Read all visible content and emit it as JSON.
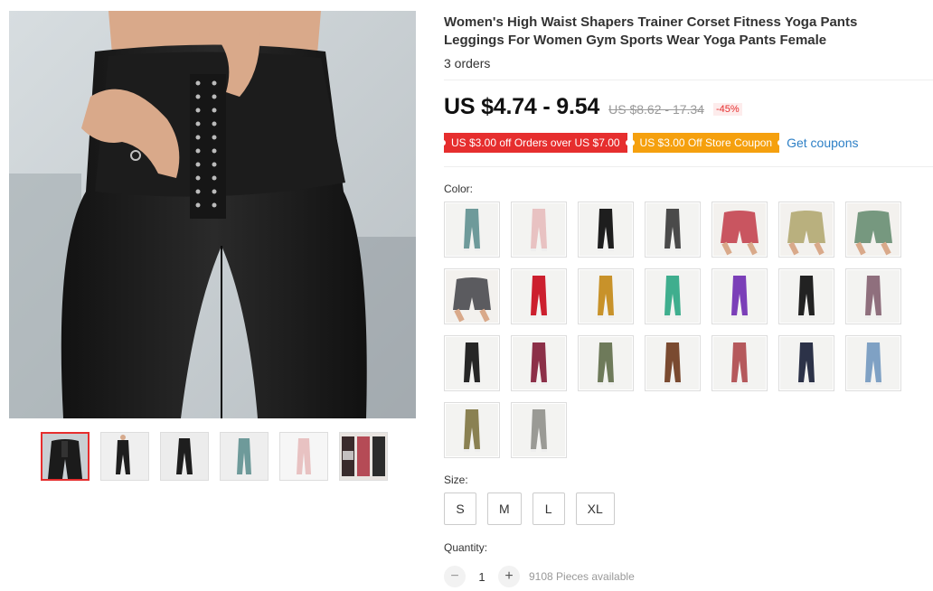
{
  "product": {
    "title": "Women's High Waist Shapers Trainer Corset Fitness Yoga Pants Leggings For Women Gym Sports Wear Yoga Pants Female",
    "orders": "3 orders",
    "price": "US $4.74 - 9.54",
    "old_price": "US $8.62 - 17.34",
    "discount": "-45%"
  },
  "coupons": {
    "store_discount": "US $3.00 off Orders over US $7.00",
    "store_coupon": "US $3.00 Off Store Coupon",
    "get_coupons": "Get coupons"
  },
  "colors": {
    "accent": "#e62e2e",
    "coupon_orange": "#f5a00e",
    "link": "#2e80c6"
  },
  "thumbnails": [
    {
      "name": "black-corset-leggings"
    },
    {
      "name": "black-leggings"
    },
    {
      "name": "black-leggings-2"
    },
    {
      "name": "teal-leggings"
    },
    {
      "name": "pink-leggings"
    },
    {
      "name": "collage"
    }
  ],
  "color_label": "Color:",
  "color_options": [
    {
      "name": "teal",
      "color": "#6e9a9a",
      "style": "leggings"
    },
    {
      "name": "light-pink",
      "color": "#e8c2c2",
      "style": "leggings"
    },
    {
      "name": "black",
      "color": "#1e1e1e",
      "style": "leggings"
    },
    {
      "name": "dark-gray",
      "color": "#4a4a4a",
      "style": "leggings"
    },
    {
      "name": "rose-red",
      "color": "#c95560",
      "style": "shorts"
    },
    {
      "name": "khaki",
      "color": "#b9b07e",
      "style": "shorts"
    },
    {
      "name": "sage-green",
      "color": "#76987f",
      "style": "shorts"
    },
    {
      "name": "gray-shorts",
      "color": "#5b5b5f",
      "style": "shorts"
    },
    {
      "name": "red",
      "color": "#cc1f2e",
      "style": "leggings"
    },
    {
      "name": "mustard",
      "color": "#c8922a",
      "style": "leggings"
    },
    {
      "name": "mint-green",
      "color": "#3fae8e",
      "style": "leggings"
    },
    {
      "name": "purple",
      "color": "#7b3fb8",
      "style": "leggings"
    },
    {
      "name": "black-2",
      "color": "#222222",
      "style": "leggings"
    },
    {
      "name": "mauve",
      "color": "#8f6f7d",
      "style": "leggings"
    },
    {
      "name": "black-3",
      "color": "#262626",
      "style": "leggings"
    },
    {
      "name": "wine",
      "color": "#8c3048",
      "style": "leggings"
    },
    {
      "name": "olive",
      "color": "#6e7a5a",
      "style": "leggings"
    },
    {
      "name": "brown",
      "color": "#7a4a30",
      "style": "leggings"
    },
    {
      "name": "dusty-rose",
      "color": "#b5595c",
      "style": "leggings"
    },
    {
      "name": "navy",
      "color": "#2c3248",
      "style": "leggings"
    },
    {
      "name": "light-blue",
      "color": "#7fa1c4",
      "style": "leggings"
    },
    {
      "name": "army-green",
      "color": "#8a8152",
      "style": "leggings"
    },
    {
      "name": "light-gray",
      "color": "#9a9a95",
      "style": "leggings"
    }
  ],
  "size_label": "Size:",
  "sizes": [
    "S",
    "M",
    "L",
    "XL"
  ],
  "quantity": {
    "label": "Quantity:",
    "minus": "−",
    "value": "1",
    "plus": "+",
    "available": "9108 Pieces available"
  }
}
